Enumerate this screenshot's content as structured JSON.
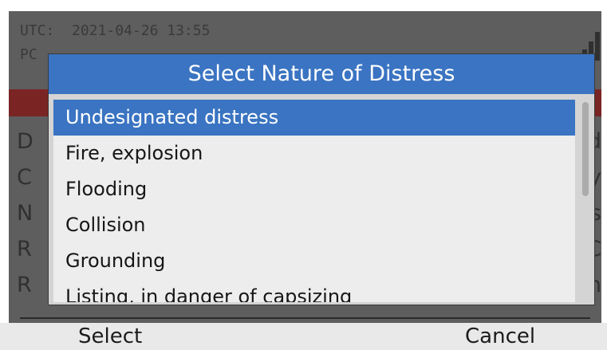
{
  "status": {
    "utc_label": "UTC:",
    "utc_value": "2021-04-26  13:55",
    "pos_label": "PC"
  },
  "background_rows": {
    "left": [
      "D",
      "C",
      "N",
      "R",
      "R"
    ],
    "right": [
      "ed",
      "dy",
      "ss",
      "TC",
      "m"
    ]
  },
  "dialog": {
    "title": "Select Nature of Distress",
    "items": [
      {
        "label": "Undesignated distress",
        "selected": true
      },
      {
        "label": "Fire, explosion",
        "selected": false
      },
      {
        "label": "Flooding",
        "selected": false
      },
      {
        "label": "Collision",
        "selected": false
      },
      {
        "label": "Grounding",
        "selected": false
      },
      {
        "label": "Listing, in danger of capsizing",
        "selected": false
      }
    ]
  },
  "softkeys": {
    "left_label": "Select",
    "right_label": "Cancel"
  },
  "colors": {
    "accent": "#3a74c2",
    "alert_bar": "#7a2424"
  }
}
